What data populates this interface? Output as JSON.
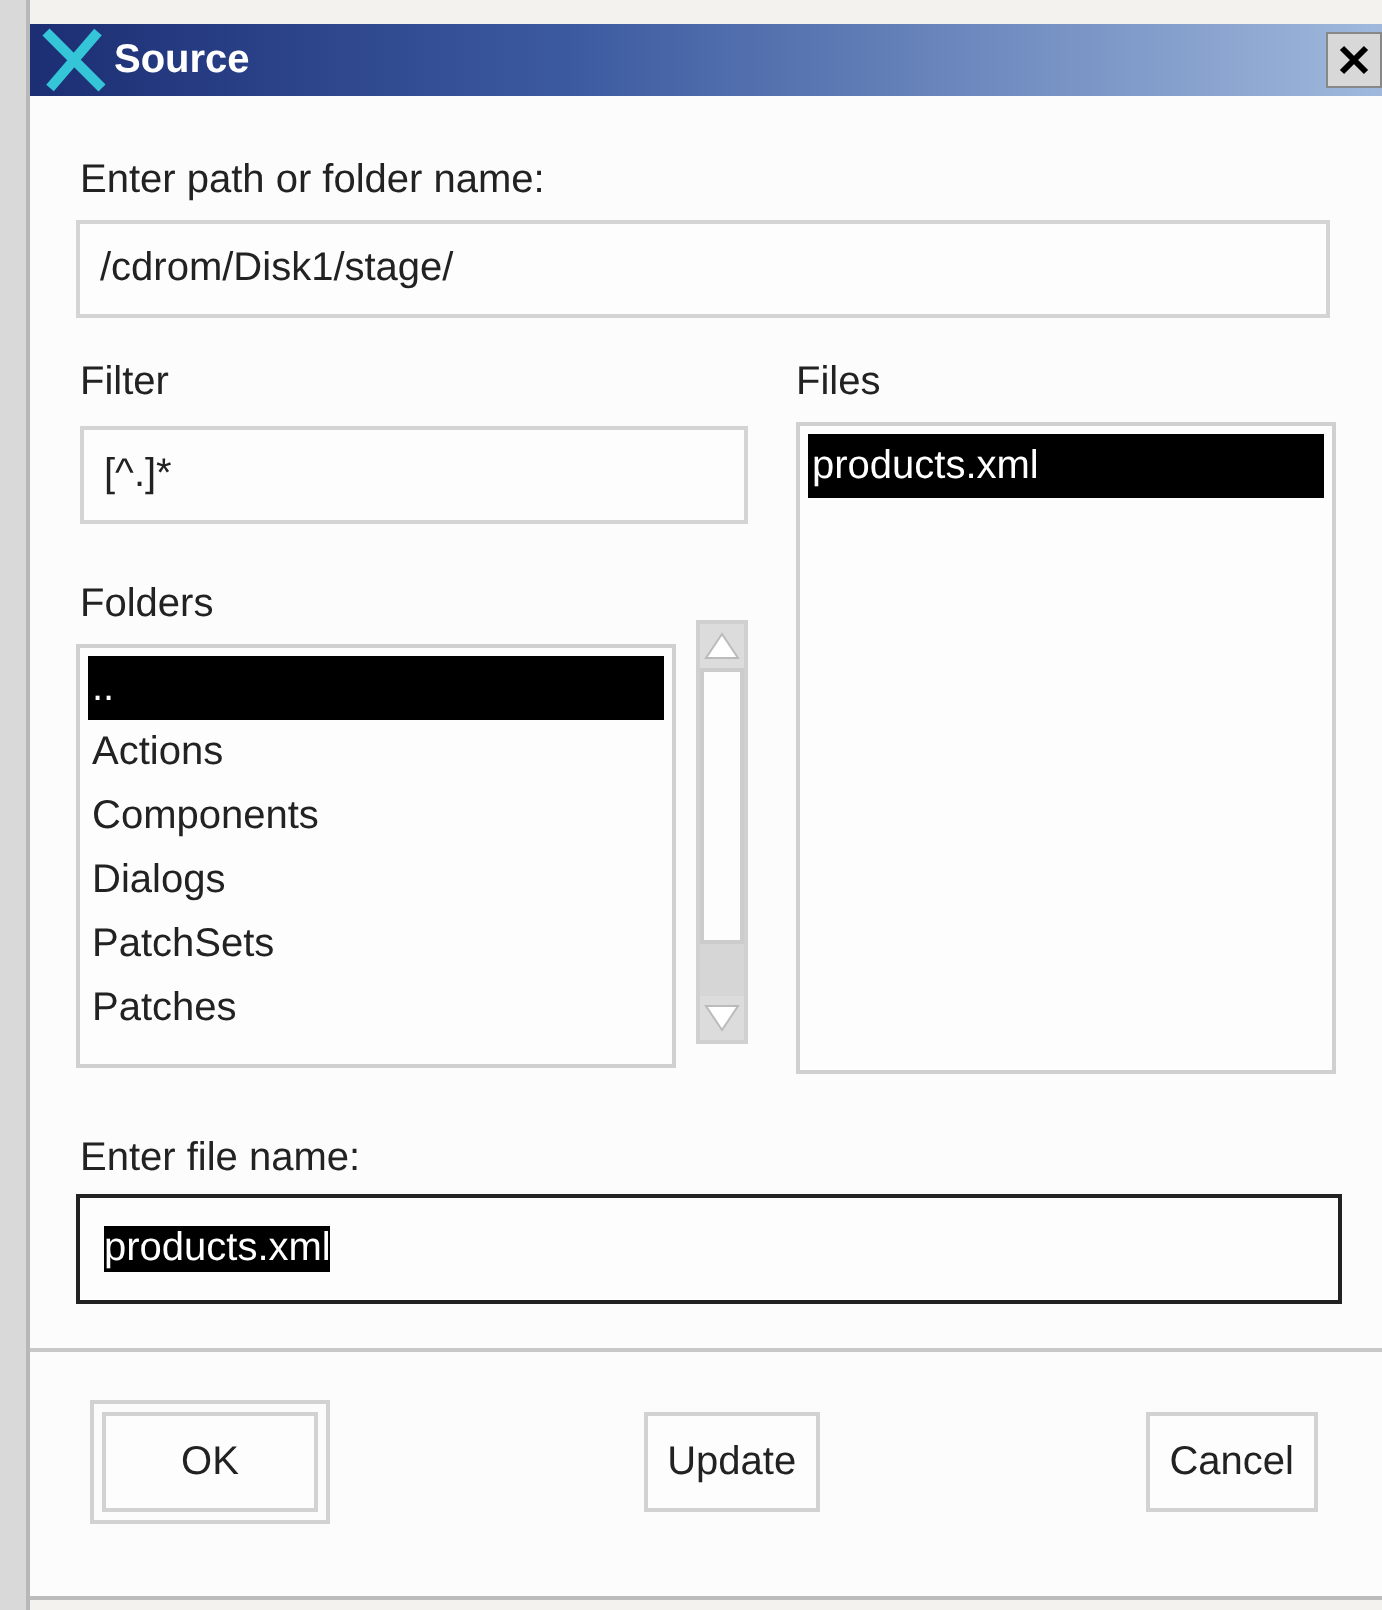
{
  "window": {
    "title": "Source"
  },
  "path": {
    "label": "Enter path or folder name:",
    "value": "/cdrom/Disk1/stage/"
  },
  "filter": {
    "label": "Filter",
    "value": "[^.]*"
  },
  "files": {
    "label": "Files",
    "items": [
      {
        "name": "products.xml",
        "selected": true
      }
    ]
  },
  "folders": {
    "label": "Folders",
    "items": [
      {
        "name": "..",
        "selected": true
      },
      {
        "name": "Actions",
        "selected": false
      },
      {
        "name": "Components",
        "selected": false
      },
      {
        "name": "Dialogs",
        "selected": false
      },
      {
        "name": "PatchSets",
        "selected": false
      },
      {
        "name": "Patches",
        "selected": false
      }
    ]
  },
  "file_name": {
    "label": "Enter file name:",
    "value": "products.xml",
    "text_selected": true
  },
  "buttons": [
    {
      "label": "OK",
      "default": true
    },
    {
      "label": "Update",
      "default": false
    },
    {
      "label": "Cancel",
      "default": false
    }
  ]
}
